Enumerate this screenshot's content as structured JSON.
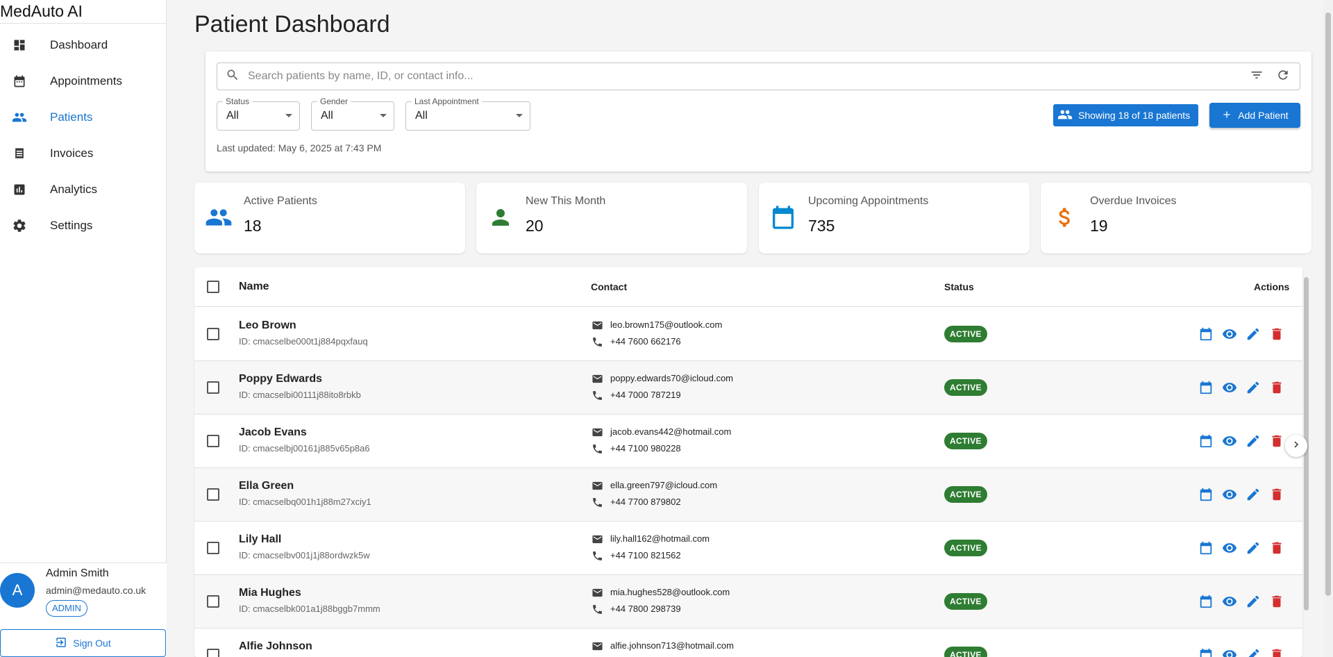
{
  "app": {
    "brand": "MedAuto AI"
  },
  "sidebar": {
    "items": [
      {
        "label": "Dashboard",
        "icon": "dashboard-icon"
      },
      {
        "label": "Appointments",
        "icon": "calendar-icon"
      },
      {
        "label": "Patients",
        "icon": "people-icon",
        "active": true
      },
      {
        "label": "Invoices",
        "icon": "receipt-icon"
      },
      {
        "label": "Analytics",
        "icon": "chart-icon"
      },
      {
        "label": "Settings",
        "icon": "gear-icon"
      }
    ]
  },
  "user": {
    "initial": "A",
    "name": "Admin Smith",
    "email": "admin@medauto.co.uk",
    "role": "ADMIN",
    "signout_label": "Sign Out"
  },
  "page": {
    "title": "Patient Dashboard"
  },
  "filters": {
    "search_placeholder": "Search patients by name, ID, or contact info...",
    "status": {
      "label": "Status",
      "value": "All"
    },
    "gender": {
      "label": "Gender",
      "value": "All"
    },
    "last_appointment": {
      "label": "Last Appointment",
      "value": "All"
    },
    "showing": "Showing 18 of 18 patients",
    "add_label": "Add Patient",
    "updated": "Last updated: May 6, 2025 at 7:43 PM"
  },
  "stats": [
    {
      "label": "Active Patients",
      "value": "18",
      "icon": "people-icon",
      "color": "#1976d2"
    },
    {
      "label": "New This Month",
      "value": "20",
      "icon": "person-icon",
      "color": "#2e7d32"
    },
    {
      "label": "Upcoming Appointments",
      "value": "735",
      "icon": "calendar-icon",
      "color": "#0288d1"
    },
    {
      "label": "Overdue Invoices",
      "value": "19",
      "icon": "dollar-icon",
      "color": "#ed6c02"
    }
  ],
  "table": {
    "headers": {
      "name": "Name",
      "contact": "Contact",
      "status": "Status",
      "actions": "Actions"
    },
    "rows": [
      {
        "name": "Leo Brown",
        "id": "ID: cmacselbe000t1j884pqxfauq",
        "email": "leo.brown175@outlook.com",
        "phone": "+44 7600 662176",
        "status": "ACTIVE"
      },
      {
        "name": "Poppy Edwards",
        "id": "ID: cmacselbi00111j88ito8rbkb",
        "email": "poppy.edwards70@icloud.com",
        "phone": "+44 7000 787219",
        "status": "ACTIVE"
      },
      {
        "name": "Jacob Evans",
        "id": "ID: cmacselbj00161j885v65p8a6",
        "email": "jacob.evans442@hotmail.com",
        "phone": "+44 7100 980228",
        "status": "ACTIVE"
      },
      {
        "name": "Ella Green",
        "id": "ID: cmacselbq001h1j88m27xciy1",
        "email": "ella.green797@icloud.com",
        "phone": "+44 7700 879802",
        "status": "ACTIVE"
      },
      {
        "name": "Lily Hall",
        "id": "ID: cmacselbv001j1j88ordwzk5w",
        "email": "lily.hall162@hotmail.com",
        "phone": "+44 7100 821562",
        "status": "ACTIVE"
      },
      {
        "name": "Mia Hughes",
        "id": "ID: cmacselbk001a1j88bggb7mmm",
        "email": "mia.hughes528@outlook.com",
        "phone": "+44 7800 298739",
        "status": "ACTIVE"
      },
      {
        "name": "Alfie Johnson",
        "id": "",
        "email": "alfie.johnson713@hotmail.com",
        "phone": "",
        "status": "ACTIVE"
      }
    ]
  },
  "colors": {
    "primary": "#1976d2",
    "active": "#2e7d32",
    "danger": "#d32f2f"
  }
}
